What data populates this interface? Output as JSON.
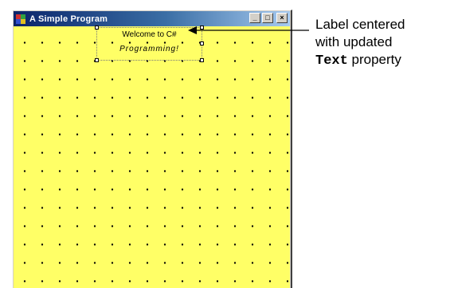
{
  "window": {
    "title": "A Simple Program",
    "icon": "app-icon",
    "buttons": [
      {
        "name": "minimize",
        "glyph": "_"
      },
      {
        "name": "maximize",
        "glyph": "□"
      },
      {
        "name": "close",
        "glyph": "×"
      }
    ],
    "client_background": "#ffff66",
    "grid_dot_color": "#000000"
  },
  "label": {
    "line1": "Welcome to C#",
    "line2": "Programming!",
    "selected": true
  },
  "annotation": {
    "line1": "Label centered",
    "line2": "with updated",
    "code": "Text",
    "line3_rest": " property"
  }
}
